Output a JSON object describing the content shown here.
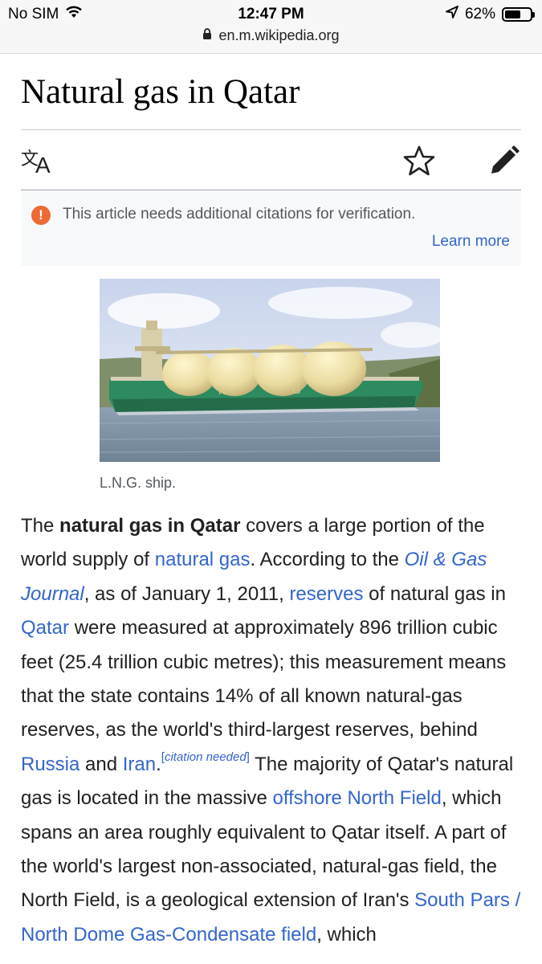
{
  "status_bar": {
    "carrier": "No SIM",
    "time": "12:47 PM",
    "battery_percent": "62%",
    "battery_level": 0.62,
    "url": "en.m.wikipedia.org"
  },
  "page": {
    "title": "Natural gas in Qatar"
  },
  "toolbar": {
    "icons": [
      "language-icon",
      "star-icon",
      "edit-pencil-icon"
    ]
  },
  "notice": {
    "text": "This article needs additional citations for verification.",
    "link": "Learn more",
    "accent_color": "#ec6a34"
  },
  "figure": {
    "caption": "L.N.G. ship."
  },
  "article": {
    "t1": "The ",
    "b1": "natural gas in Qatar",
    "t2": " covers a large portion of the world supply of ",
    "l1": "natural gas",
    "t3": ". According to the ",
    "l2": "Oil & Gas Journal",
    "t4": ", as of January 1, 2011, ",
    "l3": "reserves",
    "t5": " of natural gas in ",
    "l4": "Qatar",
    "t6": " were measured at approximately 896 trillion cubic feet (25.4 trillion cubic metres); this measurement means that the state contains 14% of all known natural-gas reserves, as the world's third-largest reserves, behind ",
    "l5": "Russia",
    "t7": " and ",
    "l6": "Iran",
    "t8": ".",
    "cite_open": "[",
    "cite": "citation needed",
    "cite_close": "]",
    "t9": " The majority of Qatar's natural gas is located in the massive ",
    "l7": "offshore North Field",
    "t10": ", which spans an area roughly equivalent to Qatar itself. A part of the world's largest non-associated, natural-gas field, the North Field, is a geological extension of Iran's ",
    "l8": "South Pars / North Dome Gas-Condensate field",
    "t11": ", which"
  },
  "colors": {
    "link": "#3366cc",
    "text": "#202122",
    "muted": "#54595d"
  }
}
